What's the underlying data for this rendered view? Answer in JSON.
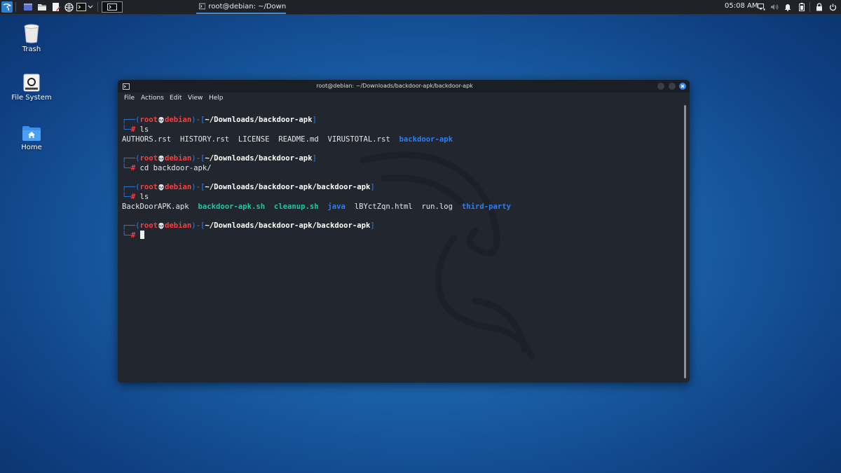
{
  "panel": {
    "task_title": "root@debian: ~/Downlo...",
    "clock": "05:08 AM"
  },
  "desktop": {
    "icons": [
      {
        "label": "Trash"
      },
      {
        "label": "File System"
      },
      {
        "label": "Home"
      }
    ]
  },
  "window": {
    "title": "root@debian: ~/Downloads/backdoor-apk/backdoor-apk",
    "menu": [
      "File",
      "Actions",
      "Edit",
      "View",
      "Help"
    ]
  },
  "terminal": {
    "user": "root",
    "host": "debian",
    "skull": "💀",
    "prompts": [
      {
        "path": "~/Downloads/backdoor-apk",
        "command": "ls"
      },
      {
        "path": "~/Downloads/backdoor-apk",
        "command": "cd backdoor-apk/"
      },
      {
        "path": "~/Downloads/backdoor-apk/backdoor-apk",
        "command": "ls"
      },
      {
        "path": "~/Downloads/backdoor-apk/backdoor-apk",
        "command": ""
      }
    ],
    "ls1": [
      "AUTHORS.rst",
      "HISTORY.rst",
      "LICENSE",
      "README.md",
      "VIRUSTOTAL.rst",
      "backdoor-apk"
    ],
    "ls2": [
      "BackDoorAPK.apk",
      "backdoor-apk.sh",
      "cleanup.sh",
      "java",
      "lBYctZqn.html",
      "run.log",
      "third-party"
    ]
  },
  "colors": {
    "prompt_frame": "#2c7ef1",
    "user_host": "#ff3b3b",
    "directory": "#2f7df0",
    "executable": "#1fc7a2"
  },
  "icons": [
    "kali-menu-icon",
    "workspace-icon",
    "file-manager-icon",
    "text-editor-icon",
    "browser-icon",
    "terminal-icon",
    "trash-icon",
    "drive-icon",
    "home-folder-icon",
    "network-icon",
    "volume-icon",
    "bell-icon",
    "battery-icon",
    "lock-icon",
    "power-icon"
  ]
}
